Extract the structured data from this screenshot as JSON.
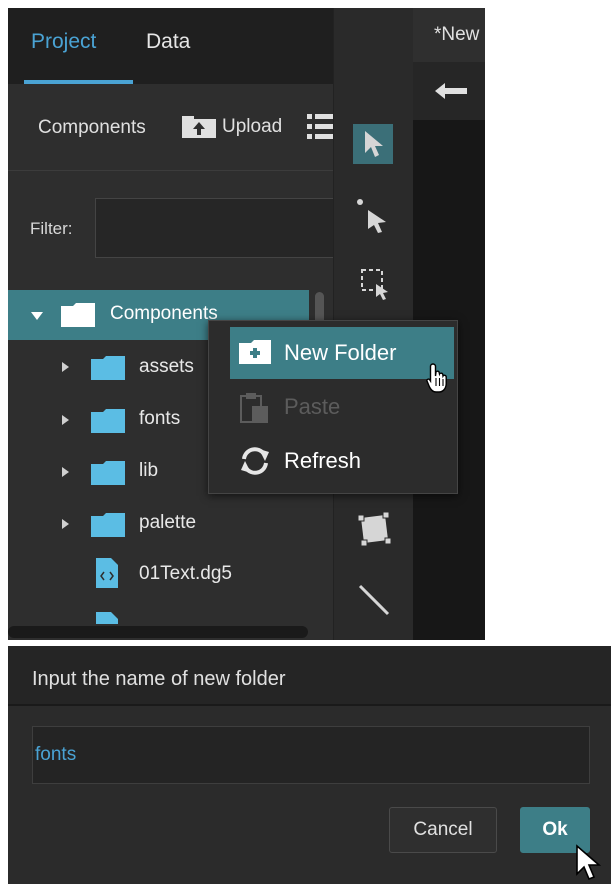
{
  "project_panel": {
    "tabs": [
      {
        "label": "Project"
      },
      {
        "label": "Data"
      }
    ],
    "toolbar": {
      "components_label": "Components",
      "upload_label": "Upload"
    },
    "filter": {
      "label": "Filter:",
      "value": ""
    },
    "tree": {
      "root_label": "Components",
      "items": [
        {
          "label": "assets",
          "type": "folder"
        },
        {
          "label": "fonts",
          "type": "folder"
        },
        {
          "label": "lib",
          "type": "folder"
        },
        {
          "label": "palette",
          "type": "folder"
        },
        {
          "label": "01Text.dg5",
          "type": "file"
        }
      ]
    }
  },
  "document": {
    "tab_label": "*New"
  },
  "context_menu": {
    "items": [
      {
        "label": "New Folder",
        "icon": "new-folder-icon",
        "state": "hovered"
      },
      {
        "label": "Paste",
        "icon": "paste-icon",
        "state": "disabled"
      },
      {
        "label": "Refresh",
        "icon": "refresh-icon",
        "state": "normal"
      }
    ]
  },
  "dialog": {
    "title": "Input the name of new folder",
    "input_value": "fonts",
    "cancel_label": "Cancel",
    "ok_label": "Ok"
  },
  "colors": {
    "accent": "#4aa3d4",
    "selection": "#3d7e87",
    "panel": "#2e2e2e",
    "folder": "#5bbde4"
  }
}
